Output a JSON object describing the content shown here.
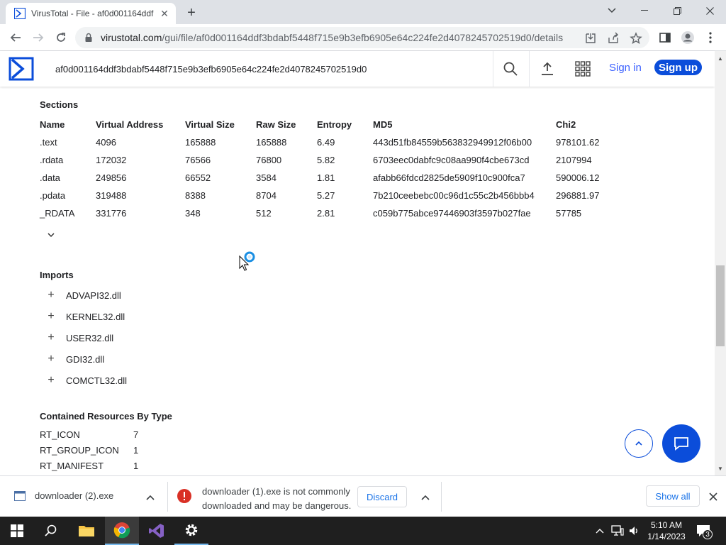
{
  "browser": {
    "tab_title": "VirusTotal - File - af0d001164ddf",
    "url_host": "virustotal.com",
    "url_path": "/gui/file/af0d001164ddf3bdabf5448f715e9b3efb6905e64c224fe2d4078245702519d0/details"
  },
  "vt": {
    "search_value": "af0d001164ddf3bdabf5448f715e9b3efb6905e64c224fe2d4078245702519d0",
    "sign_in": "Sign in",
    "sign_up": "Sign up"
  },
  "sections": {
    "title": "Sections",
    "headers": [
      "Name",
      "Virtual Address",
      "Virtual Size",
      "Raw Size",
      "Entropy",
      "MD5",
      "Chi2"
    ],
    "rows": [
      [
        ".text",
        "4096",
        "165888",
        "165888",
        "6.49",
        "443d51fb84559b563832949912f06b00",
        "978101.62"
      ],
      [
        ".rdata",
        "172032",
        "76566",
        "76800",
        "5.82",
        "6703eec0dabfc9c08aa990f4cbe673cd",
        "2107994"
      ],
      [
        ".data",
        "249856",
        "66552",
        "3584",
        "1.81",
        "afabb66fdcd2825de5909f10c900fca7",
        "590006.12"
      ],
      [
        ".pdata",
        "319488",
        "8388",
        "8704",
        "5.27",
        "7b210ceebebc00c96d1c55c2b456bbb4",
        "296881.97"
      ],
      [
        "_RDATA",
        "331776",
        "348",
        "512",
        "2.81",
        "c059b775abce97446903f3597b027fae",
        "57785"
      ]
    ]
  },
  "imports": {
    "title": "Imports",
    "items": [
      "ADVAPI32.dll",
      "KERNEL32.dll",
      "USER32.dll",
      "GDI32.dll",
      "COMCTL32.dll"
    ]
  },
  "resources": {
    "title": "Contained Resources By Type",
    "rows": [
      [
        "RT_ICON",
        "7"
      ],
      [
        "RT_GROUP_ICON",
        "1"
      ],
      [
        "RT_MANIFEST",
        "1"
      ]
    ]
  },
  "downloads": {
    "item1_name": "downloader (2).exe",
    "warning_line1": "downloader (1).exe is not commonly",
    "warning_line2": "downloaded and may be dangerous.",
    "discard": "Discard",
    "show_all": "Show all"
  },
  "taskbar": {
    "time": "5:10 AM",
    "date": "1/14/2023",
    "notif_count": "3"
  },
  "colors": {
    "vt_blue": "#0b4dda",
    "link_blue": "#3b61ff",
    "warn_red": "#d93025"
  }
}
